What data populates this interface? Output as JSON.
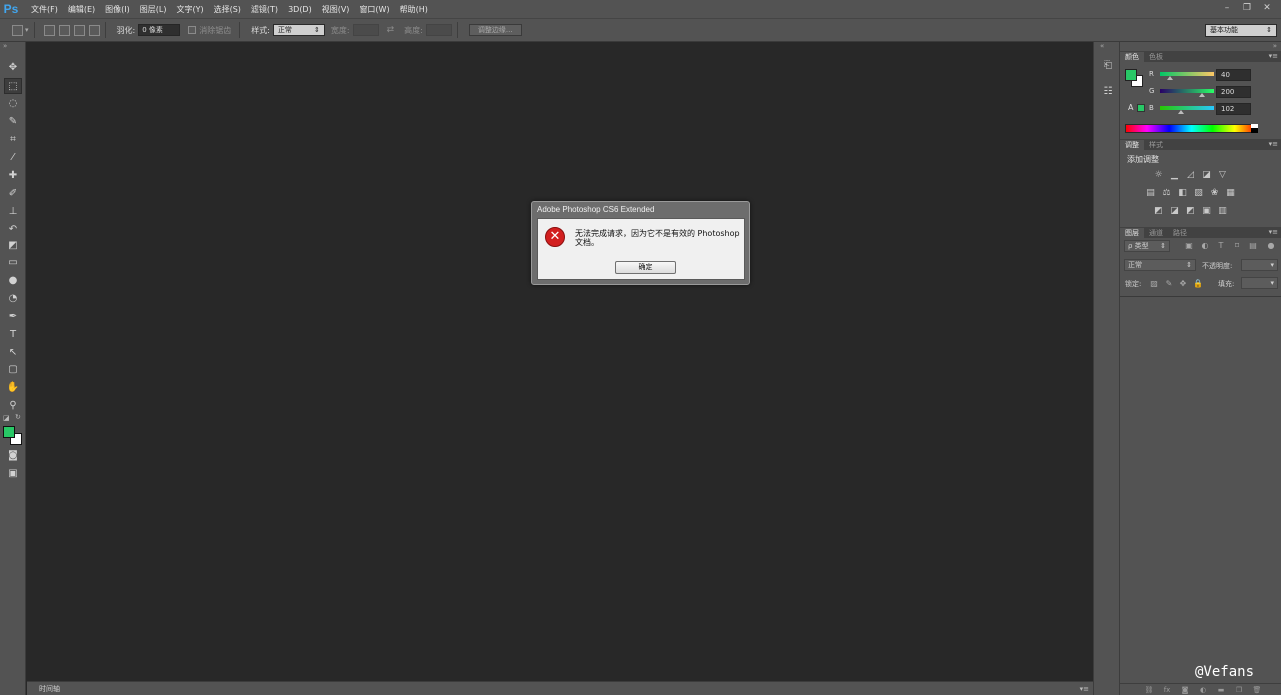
{
  "app": {
    "logo": "Ps"
  },
  "menu": [
    "文件(F)",
    "编辑(E)",
    "图像(I)",
    "图层(L)",
    "文字(Y)",
    "选择(S)",
    "滤镜(T)",
    "3D(D)",
    "视图(V)",
    "窗口(W)",
    "帮助(H)"
  ],
  "window_controls": {
    "minimize": "–",
    "restore": "❐",
    "close": "✕"
  },
  "options": {
    "feather_label": "羽化:",
    "feather_value": "0 像素",
    "antialias_label": "消除锯齿",
    "style_label": "样式:",
    "style_value": "正常",
    "width_label": "宽度:",
    "height_label": "高度:",
    "refine_edge_button": "调整边缘...",
    "workspace": "基本功能"
  },
  "tools": [
    "move-tool",
    "marquee-tool",
    "lasso-tool",
    "quick-select-tool",
    "crop-tool",
    "eyedropper-tool",
    "spot-healing-tool",
    "brush-tool",
    "clone-stamp-tool",
    "history-brush-tool",
    "eraser-tool",
    "gradient-tool",
    "blur-tool",
    "dodge-tool",
    "pen-tool",
    "type-tool",
    "path-select-tool",
    "rectangle-tool",
    "hand-tool",
    "zoom-tool"
  ],
  "colors": {
    "foreground": "#28c866",
    "background": "#ffffff"
  },
  "panels": {
    "color_tabs": [
      "颜色",
      "色板"
    ],
    "rgb": [
      {
        "label": "R",
        "value": "40"
      },
      {
        "label": "G",
        "value": "200"
      },
      {
        "label": "B",
        "value": "102"
      }
    ],
    "adjust_tabs": [
      "调整",
      "样式"
    ],
    "adjust_title": "添加调整",
    "layers_tabs": [
      "图层",
      "通道",
      "路径"
    ],
    "layers_kind": "ρ 类型",
    "blend_mode": "正常",
    "opacity_label": "不透明度:",
    "lock_label": "锁定:",
    "fill_label": "填充:"
  },
  "timeline": {
    "tab": "时间轴"
  },
  "dialog": {
    "title": "Adobe Photoshop CS6 Extended",
    "message": "无法完成请求，因为它不是有效的 Photoshop 文档。",
    "ok_label": "确定"
  },
  "watermark": "@Vefans"
}
